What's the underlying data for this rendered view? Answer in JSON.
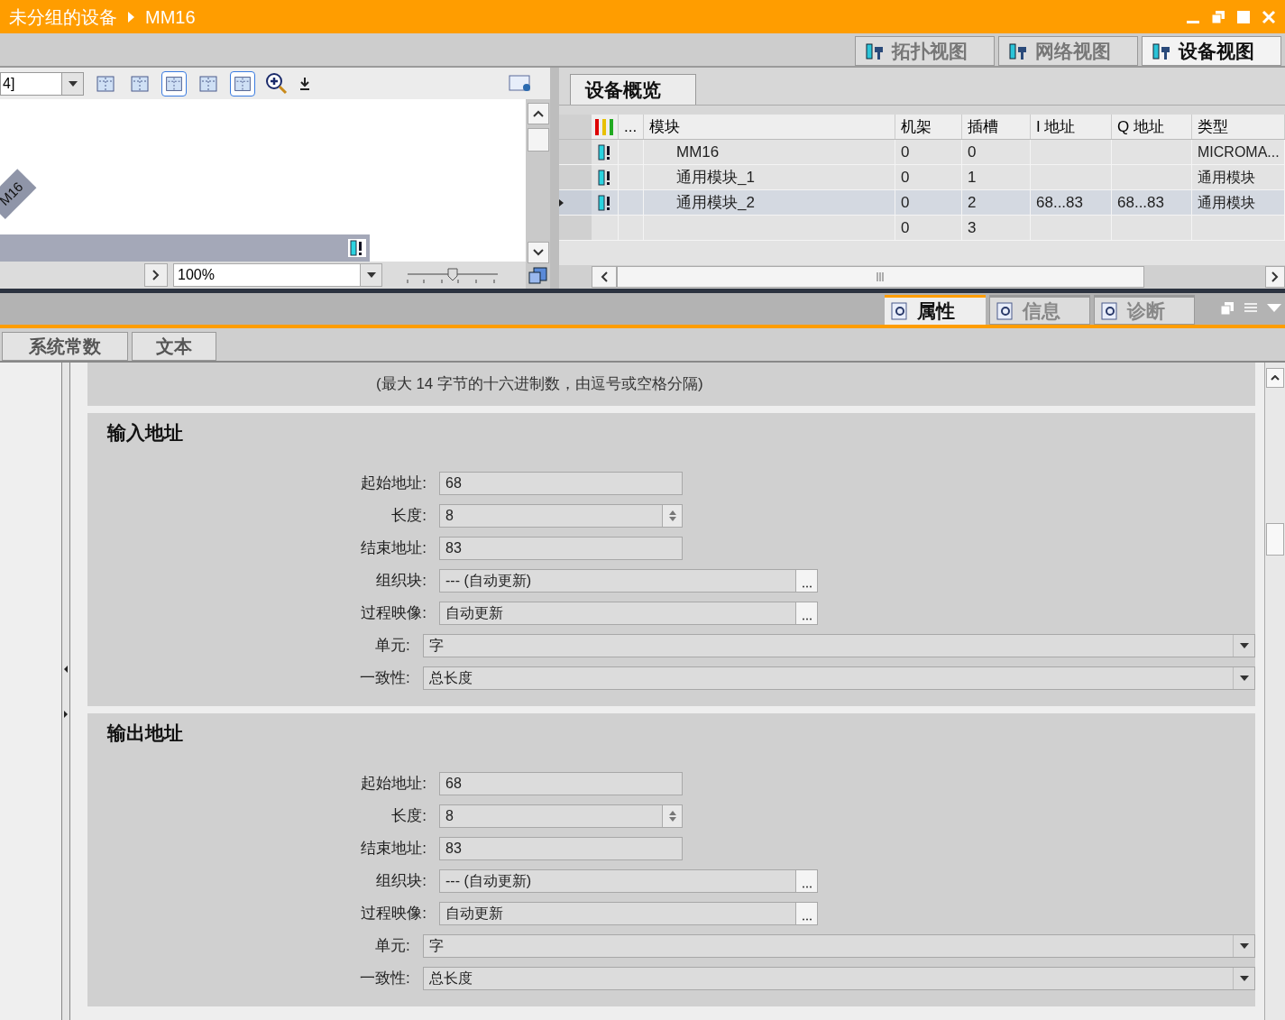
{
  "title_bar": {
    "breadcrumb": [
      "未分组的设备",
      "MM16"
    ]
  },
  "view_tabs": [
    {
      "label": "拓扑视图",
      "selected": false
    },
    {
      "label": "网络视图",
      "selected": false
    },
    {
      "label": "设备视图",
      "selected": true
    }
  ],
  "editor": {
    "device_select": "4]",
    "device_label": "M16",
    "zoom": "100%",
    "zoom_slider": {
      "level": 0.5
    }
  },
  "overview": {
    "tab": "设备概览",
    "columns": [
      "...",
      "模块",
      "机架",
      "插槽",
      "I 地址",
      "Q 地址",
      "类型"
    ],
    "rows": [
      {
        "status_icon": true,
        "module": "MM16",
        "rack": "0",
        "slot": "0",
        "i_address": "",
        "q_address": "",
        "type": "MICROMA...",
        "selected": false
      },
      {
        "status_icon": true,
        "module": "通用模块_1",
        "rack": "0",
        "slot": "1",
        "i_address": "",
        "q_address": "",
        "type": "通用模块",
        "selected": false
      },
      {
        "status_icon": true,
        "module": "通用模块_2",
        "rack": "0",
        "slot": "2",
        "i_address": "68...83",
        "q_address": "68...83",
        "type": "通用模块",
        "selected": true
      },
      {
        "status_icon": false,
        "module": "",
        "rack": "0",
        "slot": "3",
        "i_address": "",
        "q_address": "",
        "type": "",
        "selected": false
      }
    ]
  },
  "inspector_tabs": [
    {
      "label": "属性",
      "selected": true
    },
    {
      "label": "信息",
      "selected": false
    },
    {
      "label": "诊断",
      "selected": false
    }
  ],
  "sub_tabs": [
    "系统常数",
    "文本"
  ],
  "hint": "(最大 14 字节的十六进制数，由逗号或空格分隔)",
  "sections": [
    {
      "title": "输入地址",
      "fields": [
        {
          "label": "起始地址:",
          "value": "68",
          "kind": "text"
        },
        {
          "label": "长度:",
          "value": "8",
          "kind": "spin"
        },
        {
          "label": "结束地址:",
          "value": "83",
          "kind": "text"
        },
        {
          "label": "组织块:",
          "value": "--- (自动更新)",
          "kind": "browse"
        },
        {
          "label": "过程映像:",
          "value": "自动更新",
          "kind": "browse"
        },
        {
          "label": "单元:",
          "value": "字",
          "kind": "select"
        },
        {
          "label": "一致性:",
          "value": "总长度",
          "kind": "select"
        }
      ]
    },
    {
      "title": "输出地址",
      "fields": [
        {
          "label": "起始地址:",
          "value": "68",
          "kind": "text"
        },
        {
          "label": "长度:",
          "value": "8",
          "kind": "spin"
        },
        {
          "label": "结束地址:",
          "value": "83",
          "kind": "text"
        },
        {
          "label": "组织块:",
          "value": "--- (自动更新)",
          "kind": "browse"
        },
        {
          "label": "过程映像:",
          "value": "自动更新",
          "kind": "browse"
        },
        {
          "label": "单元:",
          "value": "字",
          "kind": "select"
        },
        {
          "label": "一致性:",
          "value": "总长度",
          "kind": "select"
        }
      ]
    }
  ]
}
